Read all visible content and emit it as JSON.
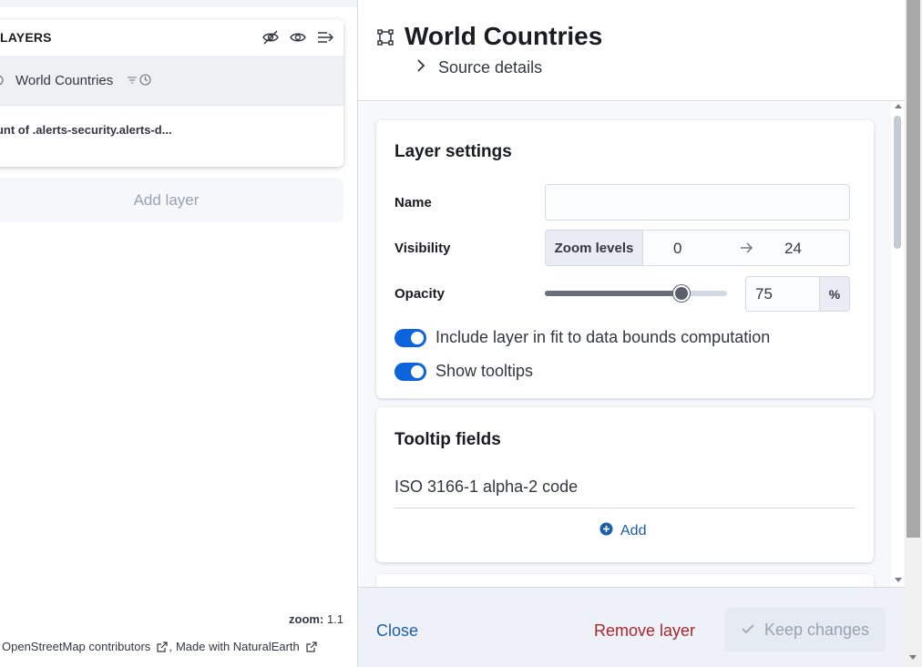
{
  "map": {
    "layers_panel": {
      "title": "LAYERS",
      "icons": [
        "eye-closed-icon",
        "eye-icon",
        "collapse-panel-icon"
      ],
      "layers": [
        {
          "name": "World Countries",
          "selected": true,
          "meta_icons": [
            "filter-icon",
            "clock-icon"
          ]
        },
        {
          "name": "ount of .alerts-security.alerts-d...",
          "selected": false
        }
      ]
    },
    "add_layer_label": "Add layer",
    "zoom": {
      "label": "zoom:",
      "value": "1.1"
    },
    "attribution": {
      "part1": "OpenStreetMap contributors",
      "separator": ",",
      "part2": "Made with NaturalEarth"
    }
  },
  "flyout": {
    "title": "World Countries",
    "title_icon": "vector-layer-icon",
    "source_details_label": "Source details",
    "layer_settings": {
      "title": "Layer settings",
      "name_label": "Name",
      "name_value": "",
      "visibility_label": "Visibility",
      "zoom_levels_label": "Zoom levels",
      "zoom_min": "0",
      "zoom_max": "24",
      "opacity_label": "Opacity",
      "opacity_value": "75",
      "opacity_fraction": 0.75,
      "opacity_unit": "%",
      "toggle_fit_label": "Include layer in fit to data bounds computation",
      "toggle_fit_on": true,
      "toggle_tooltips_label": "Show tooltips",
      "toggle_tooltips_on": true
    },
    "tooltip_fields": {
      "title": "Tooltip fields",
      "fields": [
        "ISO 3166-1 alpha-2 code"
      ],
      "add_label": "Add"
    },
    "footer": {
      "close_label": "Close",
      "remove_label": "Remove layer",
      "keep_label": "Keep changes"
    }
  },
  "colors": {
    "primary": "#0b64dd",
    "link": "#1d5ea8",
    "danger": "#a8262c",
    "disabled_text": "#98a2b3"
  }
}
